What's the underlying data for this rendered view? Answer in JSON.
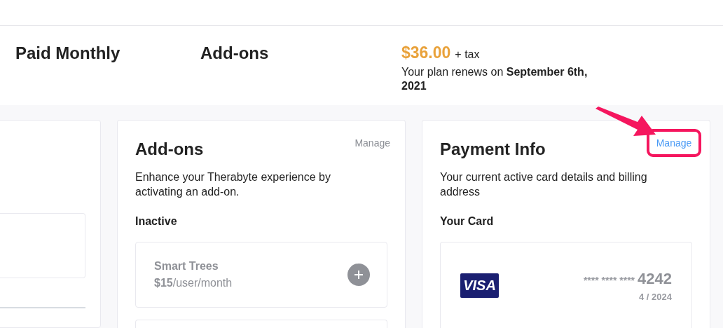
{
  "summary": {
    "plan": "Paid Monthly",
    "addons": "Add-ons",
    "price": "$36.00",
    "tax": "+ tax",
    "renewal": "Your plan renews on **September 6th, 2021**"
  },
  "addons_card": {
    "title": "Add-ons",
    "manage": "Manage",
    "description": "Enhance your Therabyte experience by activating an add-on.",
    "section": "Inactive",
    "items": [
      {
        "name": "Smart Trees",
        "price": "**$15**/user/month"
      }
    ]
  },
  "payment_card": {
    "title": "Payment Info",
    "manage": "Manage",
    "highlighted": true,
    "description": "Your current active card details and billing address",
    "section": "Your Card",
    "card": {
      "brand": "VISA",
      "number": "**** **** ****",
      "last4": "4242",
      "expiry": "4 / 2024"
    }
  }
}
